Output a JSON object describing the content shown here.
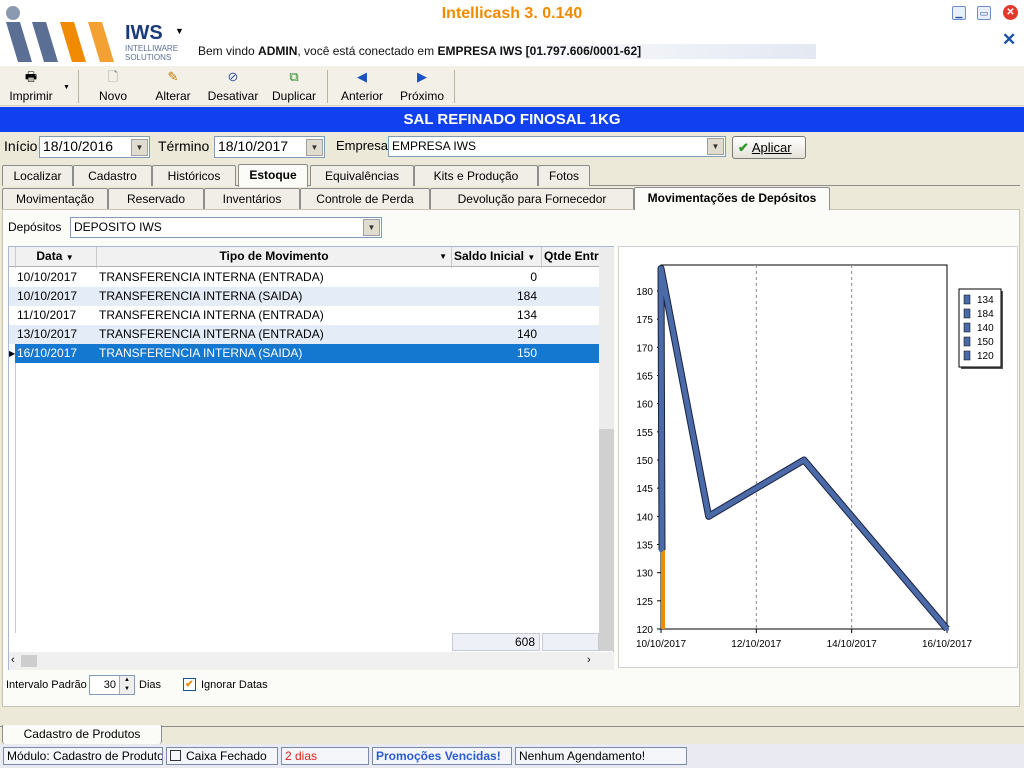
{
  "app": {
    "title": "Intellicash 3. 0.140",
    "logo_text": "IWS",
    "logo_sub1": "INTELLIWARE",
    "logo_sub2": "SOLUTIONS",
    "welcome_prefix": "Bem vindo ",
    "welcome_user": "ADMIN",
    "welcome_mid": ", você está conectado em ",
    "welcome_company": "EMPRESA IWS [01.797.606/0001-62]"
  },
  "toolbar": {
    "print": "Imprimir",
    "new": "Novo",
    "edit": "Alterar",
    "disable": "Desativar",
    "duplicate": "Duplicar",
    "previous": "Anterior",
    "next": "Próximo"
  },
  "product_title": "SAL REFINADO FINOSAL 1KG",
  "filters": {
    "start_label": "Início",
    "start_value": "18/10/2016",
    "end_label": "Término",
    "end_value": "18/10/2017",
    "company_label": "Empresa",
    "company_value": "EMPRESA IWS",
    "apply_label": "Aplicar"
  },
  "tabs_top": [
    "Localizar",
    "Cadastro",
    "Históricos",
    "Estoque",
    "Equivalências",
    "Kits e Produção",
    "Fotos"
  ],
  "tabs_top_active": "Estoque",
  "tabs_sub": [
    "Movimentação",
    "Reservado",
    "Inventários",
    "Controle de Perda",
    "Devolução para Fornecedor",
    "Movimentações de Depósitos"
  ],
  "tabs_sub_active": "Movimentações de Depósitos",
  "deposit": {
    "label": "Depósitos",
    "value": "DEPOSITO IWS"
  },
  "grid": {
    "columns": [
      "Data",
      "Tipo de Movimento",
      "Saldo Inicial",
      "Qtde Entra"
    ],
    "rows": [
      {
        "data": "10/10/2017",
        "tipo": "TRANSFERENCIA INTERNA (ENTRADA)",
        "saldo": "0",
        "qtde": ""
      },
      {
        "data": "10/10/2017",
        "tipo": "TRANSFERENCIA INTERNA (SAIDA)",
        "saldo": "184",
        "qtde": ""
      },
      {
        "data": "11/10/2017",
        "tipo": "TRANSFERENCIA INTERNA (ENTRADA)",
        "saldo": "134",
        "qtde": ""
      },
      {
        "data": "13/10/2017",
        "tipo": "TRANSFERENCIA INTERNA (ENTRADA)",
        "saldo": "140",
        "qtde": ""
      },
      {
        "data": "16/10/2017",
        "tipo": "TRANSFERENCIA INTERNA (SAIDA)",
        "saldo": "150",
        "qtde": ""
      }
    ],
    "selected_row": 4,
    "footer_total": "608"
  },
  "interval": {
    "label": "Intervalo Padrão",
    "value": "30",
    "unit": "Dias",
    "ignore_label": "Ignorar Datas",
    "ignore_checked": true
  },
  "bottom_tab": "Cadastro de Produtos",
  "status": {
    "module": "Módulo: Cadastro de Produtos",
    "cash": "Caixa Fechado",
    "days": "2 dias",
    "promo": "Promoções Vencidas!",
    "schedule": "Nenhum Agendamento!"
  },
  "colors": {
    "banner": "#1040f0",
    "selected_row": "#1478d0",
    "title": "#f08a00",
    "line": "#4a6aa8",
    "area_orange": "#f08a00"
  },
  "chart_data": {
    "type": "line",
    "x": [
      "10/10/2017",
      "10/10/2017",
      "11/10/2017",
      "13/10/2017",
      "16/10/2017"
    ],
    "values": [
      134,
      184,
      140,
      150,
      120
    ],
    "x_tick_labels": [
      "10/10/2017",
      "12/10/2017",
      "14/10/2017",
      "16/10/2017"
    ],
    "y_ticks": [
      120,
      125,
      130,
      135,
      140,
      145,
      150,
      155,
      160,
      165,
      170,
      175,
      180
    ],
    "ylim": [
      120,
      180
    ],
    "legend": [
      "134",
      "184",
      "140",
      "150",
      "120"
    ],
    "legend_position": "top-right",
    "grid": true
  }
}
